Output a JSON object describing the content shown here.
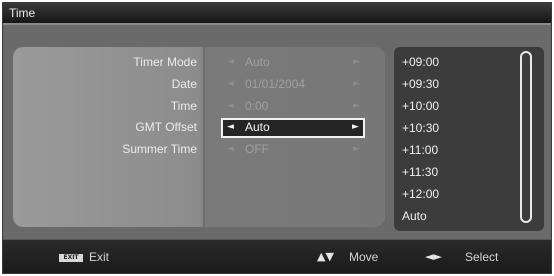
{
  "window": {
    "title": "Time"
  },
  "settings": [
    {
      "label": "Timer Mode",
      "value": "Auto",
      "selected": false
    },
    {
      "label": "Date",
      "value": "01/01/2004",
      "selected": false
    },
    {
      "label": "Time",
      "value": "0:00",
      "selected": false
    },
    {
      "label": "GMT Offset",
      "value": "Auto",
      "selected": true
    },
    {
      "label": "Summer Time",
      "value": "OFF",
      "selected": false
    }
  ],
  "offset_list": [
    "+09:00",
    "+09:30",
    "+10:00",
    "+10:30",
    "+11:00",
    "+11:30",
    "+12:00",
    "Auto"
  ],
  "footer": {
    "exit_key": "EXIT",
    "exit_label": "Exit",
    "move_label": "Move",
    "select_label": "Select"
  },
  "icons": {
    "left": "arrow-left-icon",
    "right": "arrow-right-icon",
    "move": "up-down-arrows-icon",
    "select": "left-right-arrows-icon"
  },
  "colors": {
    "panel": "#8c8c8c",
    "selection_border": "#f2f2f2",
    "list_bg": "#3c3c3c",
    "footer_bg": "#1e1e1e"
  }
}
